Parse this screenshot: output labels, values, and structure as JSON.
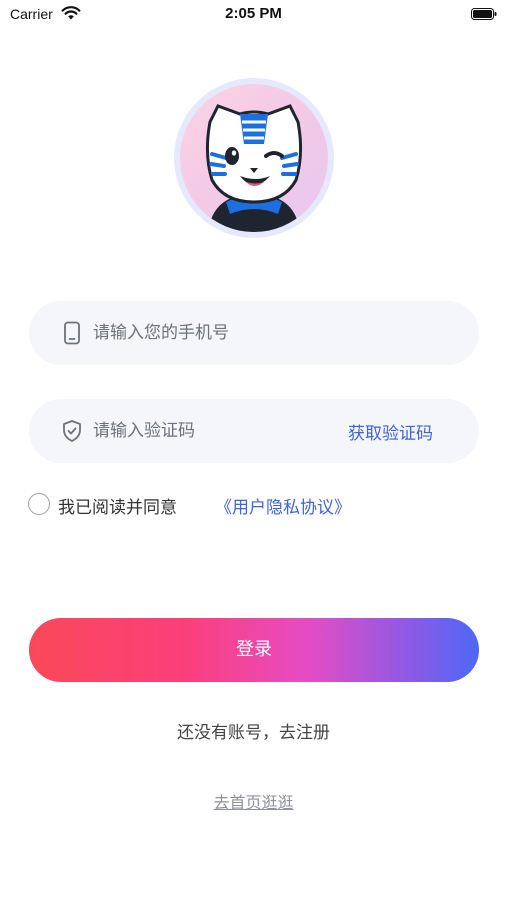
{
  "status_bar": {
    "carrier": "Carrier",
    "time": "2:05 PM",
    "wifi_icon": "wifi-icon",
    "battery_icon": "battery-icon"
  },
  "avatar": {
    "icon": "tiger-mascot-avatar"
  },
  "phone_field": {
    "icon": "phone-icon",
    "placeholder": "请输入您的手机号",
    "value": ""
  },
  "code_field": {
    "icon": "shield-icon",
    "placeholder": "请输入验证码",
    "value": "",
    "get_code_label": "获取验证码"
  },
  "agreement": {
    "checked": false,
    "text": "我已阅读并同意",
    "link_label": "《用户隐私协议》"
  },
  "login_button": {
    "label": "登录"
  },
  "register_link": "还没有账号，去注册",
  "home_link": "去首页逛逛",
  "colors": {
    "accent_blue": "#3f63d8",
    "field_bg": "#f4f6f9",
    "button_gradient_start": "#fb4858",
    "button_gradient_end": "#4d68f5"
  }
}
